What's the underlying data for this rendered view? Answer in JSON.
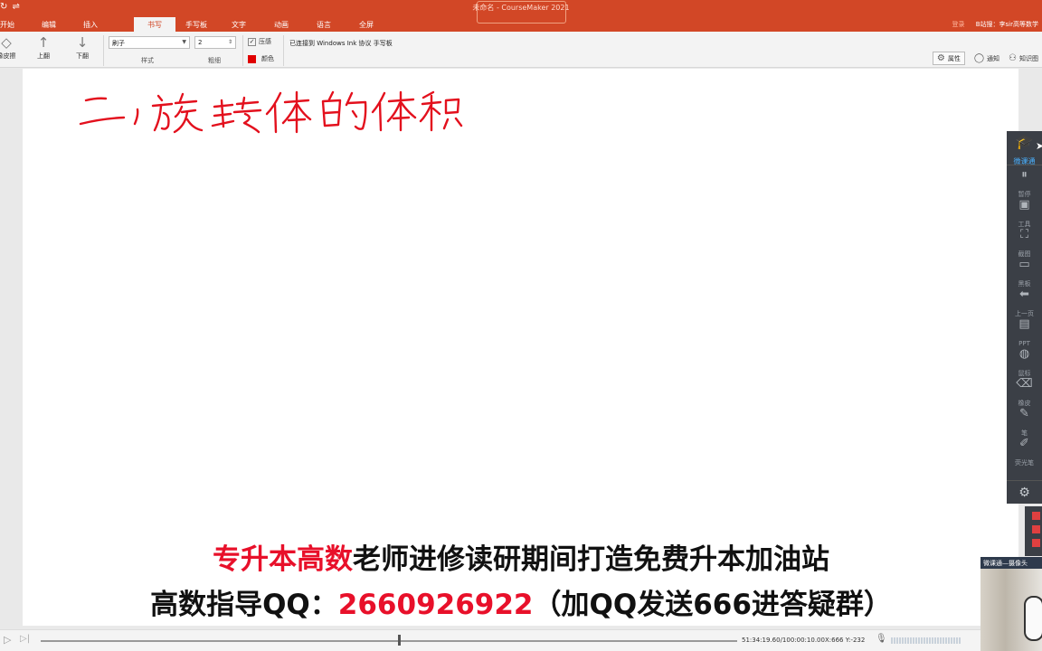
{
  "titlebar": {
    "quick_access": "↻ ⇌",
    "title": "未命名 - CourseMaker 2021",
    "menus": [
      {
        "label": "开始",
        "active": false
      },
      {
        "label": "编辑",
        "active": false
      },
      {
        "label": "插入",
        "active": false
      },
      {
        "label": "书写",
        "active": true
      },
      {
        "label": "手写板",
        "active": false
      },
      {
        "label": "文字",
        "active": false
      },
      {
        "label": "动画",
        "active": false
      },
      {
        "label": "语言",
        "active": false
      },
      {
        "label": "全屏",
        "active": false
      }
    ],
    "account_dim": "登录",
    "account": "B站搜：李sir高等数学"
  },
  "ribbon": {
    "eraser_label": "橡皮擦",
    "page_up_label": "上翻",
    "page_down_label": "下翻",
    "brush_value": "刷子",
    "style_label": "样式",
    "width_value": "2",
    "width_label": "粗细",
    "pressure_label": "压感",
    "pressure_checked": true,
    "color_label": "颜色",
    "pen_color": "#e00000",
    "ink_message": "已连接到 Windows Ink 协议 手写板",
    "properties_label": "属性",
    "notify_label": "通知",
    "knowledge_label": "知识图"
  },
  "canvas": {
    "handwriting": "二，旋转体的体积",
    "ink_color": "#e3101d"
  },
  "side_toolbar": {
    "brand": "微课通",
    "items": [
      {
        "label": "暂停",
        "icon": "pause-icon",
        "glyph": "⏸"
      },
      {
        "label": "工具",
        "icon": "toolbox-icon",
        "glyph": "▣"
      },
      {
        "label": "截图",
        "icon": "screenshot-icon",
        "glyph": "⛶"
      },
      {
        "label": "黑板",
        "icon": "blackboard-icon",
        "glyph": "▭"
      },
      {
        "label": "上一页",
        "icon": "arrow-left-icon",
        "glyph": "⬅"
      },
      {
        "label": "PPT",
        "icon": "ppt-icon",
        "glyph": "▤"
      },
      {
        "label": "鼠标",
        "icon": "mouse-icon",
        "glyph": "◍"
      },
      {
        "label": "橡皮",
        "icon": "eraser-icon",
        "glyph": "⌫"
      },
      {
        "label": "笔",
        "icon": "pen-icon",
        "glyph": "✎"
      },
      {
        "label": "荧光笔",
        "icon": "highlighter-icon",
        "glyph": "✐"
      }
    ]
  },
  "webcam": {
    "title": "微课通—摄像头"
  },
  "subtitles": {
    "line1_red": "专升本高数",
    "line1_black": "老师进修读研期间打造免费升本加油站",
    "line2_black_a": "高数指导QQ：",
    "line2_red": "2660926922",
    "line2_black_b": "（加QQ发送666进答疑群）"
  },
  "timeline": {
    "progress_fraction": 0.514,
    "time": "51:34:19.60/100:00:10.00",
    "coords": "X:666 Y:-232"
  }
}
